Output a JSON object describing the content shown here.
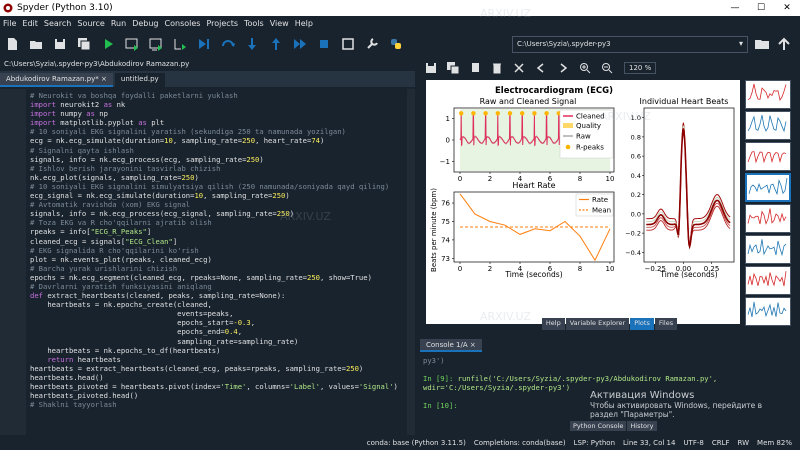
{
  "window": {
    "title": "Spyder (Python 3.10)",
    "min": "—",
    "max": "☐",
    "close": "✕"
  },
  "menu": [
    "File",
    "Edit",
    "Search",
    "Source",
    "Run",
    "Debug",
    "Consoles",
    "Projects",
    "Tools",
    "View",
    "Help"
  ],
  "toolbar": {
    "icons": [
      "new-file-icon",
      "open-file-icon",
      "save-icon",
      "save-all-icon",
      "run-icon",
      "run-cell-icon",
      "run-cell-advance-icon",
      "run-selection-icon",
      "debug-icon",
      "step-icon",
      "step-into-icon",
      "step-return-icon",
      "continue-icon",
      "stop-debug-icon",
      "maximize-icon",
      "preferences-icon",
      "python-path-icon"
    ],
    "working_dir": "C:\\Users\\Syzia\\.spyder-py3",
    "accent": "#1a72bb"
  },
  "editor": {
    "file_path": "C:\\Users\\Syzia\\.spyder-py3\\Abdukodirov Ramazan.py",
    "tabs": [
      "Abdukodirov Ramazan.py*",
      "untitled.py"
    ],
    "code": [
      "# Neurokit va boshqa foydalli paketlarni yuklash",
      "import neurokit2 as nk",
      "import numpy as np",
      "import matplotlib.pyplot as plt",
      "# 10 soniyali EKG signalini yaratish (sekundiga 250 ta namunada yozilgan)",
      "ecg = nk.ecg_simulate(duration=10, sampling_rate=250, heart_rate=74)",
      "# Signalni qayta ishlash",
      "signals, info = nk.ecg_process(ecg, sampling_rate=250)",
      "# Ishlov berish jarayonini tasvirlab chizish",
      "nk.ecg_plot(signals, sampling_rate=250)",
      "# 10 soniyali EKG signalini simulyatsiya qilish (250 namunada/soniyada qayd qiling)",
      "ecg_signal = nk.ecg_simulate(duration=10, sampling_rate=250)",
      "# Avtomatik ravishda (xom) EKG signal",
      "signals, info = nk.ecg_process(ecg_signal, sampling_rate=250)",
      "# Toza EKG va R cho'qqilarni ajratib olish",
      "rpeaks = info[\"ECG_R_Peaks\"]",
      "cleaned_ecg = signals[\"ECG_Clean\"]",
      "# EKG signalida R cho'qqilarini ko'rish",
      "plot = nk.events_plot(rpeaks, cleaned_ecg)",
      "# Barcha yurak urishlarini chizish",
      "epochs = nk.ecg_segment(cleaned_ecg, rpeaks=None, sampling_rate=250, show=True)",
      "# Davrlarni yaratish funksiyasini aniqlang",
      "def extract_heartbeats(cleaned, peaks, sampling_rate=None):",
      "    heartbeats = nk.epochs_create(cleaned,",
      "                                  events=peaks,",
      "                                  epochs_start=-0.3,",
      "                                  epochs_end=0.4,",
      "                                  sampling_rate=sampling_rate)",
      "    heartbeats = nk.epochs_to_df(heartbeats)",
      "    return heartbeats",
      "heartbeats = extract_heartbeats(cleaned_ecg, peaks=rpeaks, sampling_rate=250)",
      "heartbeats.head()",
      "heartbeats_pivoted = heartbeats.pivot(index='Time', columns='Label', values='Signal')",
      "heartbeats_pivoted.head()",
      "# Shaklni tayyorlash"
    ]
  },
  "plots": {
    "toolbar_icons": [
      "save-plot-icon",
      "save-all-plots-icon",
      "copy-icon",
      "remove-plot-icon",
      "remove-all-icon",
      "previous-icon",
      "next-icon",
      "zoom-in-icon",
      "zoom-out-icon"
    ],
    "zoom": "120 %",
    "figure_title": "Electrocardiogram (ECG)",
    "chart_data": [
      {
        "type": "line",
        "title": "Raw and Cleaned Signal",
        "xlabel": "",
        "ylabel": "",
        "x_ticks": [
          "0",
          "2",
          "4",
          "6",
          "8",
          "10"
        ],
        "y_ticks": [
          "1",
          "0",
          "−1"
        ],
        "xlim": [
          0,
          10
        ],
        "ylim": [
          -1.5,
          1.5
        ],
        "legend": [
          "Cleaned",
          "Quality",
          "Raw",
          "R-peaks"
        ],
        "legend_position": "right",
        "series_colors": {
          "Cleaned": "#e0305a",
          "Quality": "#ffd766",
          "Raw": "#c8c8c8",
          "R-peaks": "#ffb400"
        }
      },
      {
        "type": "line",
        "title": "Heart Rate",
        "xlabel": "Time (seconds)",
        "ylabel": "Beats per minute (bpm)",
        "x_ticks": [
          "0",
          "2",
          "4",
          "6",
          "8",
          "10"
        ],
        "y_ticks": [
          "76",
          "75",
          "74",
          "73"
        ],
        "xlim": [
          0,
          10
        ],
        "ylim": [
          72.8,
          76.6
        ],
        "legend": [
          "Rate",
          "Mean"
        ],
        "legend_position": "top-right",
        "series": [
          {
            "name": "Rate",
            "x": [
              0,
              1,
              2,
              3,
              4,
              5,
              6,
              7,
              8,
              9,
              10
            ],
            "values": [
              76.5,
              75.4,
              75.0,
              74.8,
              74.3,
              74.6,
              74.5,
              75.0,
              74.2,
              72.9,
              74.6
            ]
          },
          {
            "name": "Mean",
            "x": [
              0,
              10
            ],
            "values": [
              74.7,
              74.7
            ]
          }
        ]
      },
      {
        "type": "line",
        "title": "Individual Heart Beats",
        "xlabel": "Time (seconds)",
        "ylabel": "",
        "x_ticks": [
          "−0.25",
          "0.00",
          "0.25"
        ],
        "y_ticks": [
          "1.0",
          "0.8",
          "0.6",
          "0.4",
          "0.2",
          "0.0",
          "−0.2",
          "−0.4"
        ],
        "xlim": [
          -0.35,
          0.45
        ],
        "ylim": [
          -0.5,
          1.1
        ],
        "legend_position": "none"
      }
    ],
    "thumb_count": 8,
    "panel_tabs": [
      "Help",
      "Variable Explorer",
      "Plots",
      "Files"
    ]
  },
  "console": {
    "tab": "Console 1/A",
    "lines": [
      {
        "kind": "out",
        "text": "py3')"
      },
      {
        "kind": "blank",
        "text": ""
      },
      {
        "kind": "in",
        "prompt": "In [9]:",
        "text": " runfile('C:/Users/Syzia/.spyder-py3/Abdukodirov Ramazan.py', wdir='C:/Users/Syzia/.spyder-py3')"
      },
      {
        "kind": "blank",
        "text": ""
      },
      {
        "kind": "in",
        "prompt": "In [10]:",
        "text": ""
      }
    ],
    "bottom_tabs": [
      "Python Console",
      "History"
    ]
  },
  "watermark": {
    "line1": "Активация Windows",
    "line2": "Чтобы активировать Windows, перейдите в",
    "line3": "раздел \"Параметры\"."
  },
  "faint_text": [
    "ARXIV.UZ",
    "ARXIV.UZ",
    "ARXIV.UZ",
    "ARXIV.UZ"
  ],
  "status": {
    "env": "conda: base (Python 3.11.5)",
    "completions": "Completions: conda(base)",
    "lsp": "LSP: Python",
    "position": "Line 33, Col 14",
    "encoding": "UTF-8",
    "eol": "CRLF",
    "rw": "RW",
    "mem": "Mem 82%"
  }
}
